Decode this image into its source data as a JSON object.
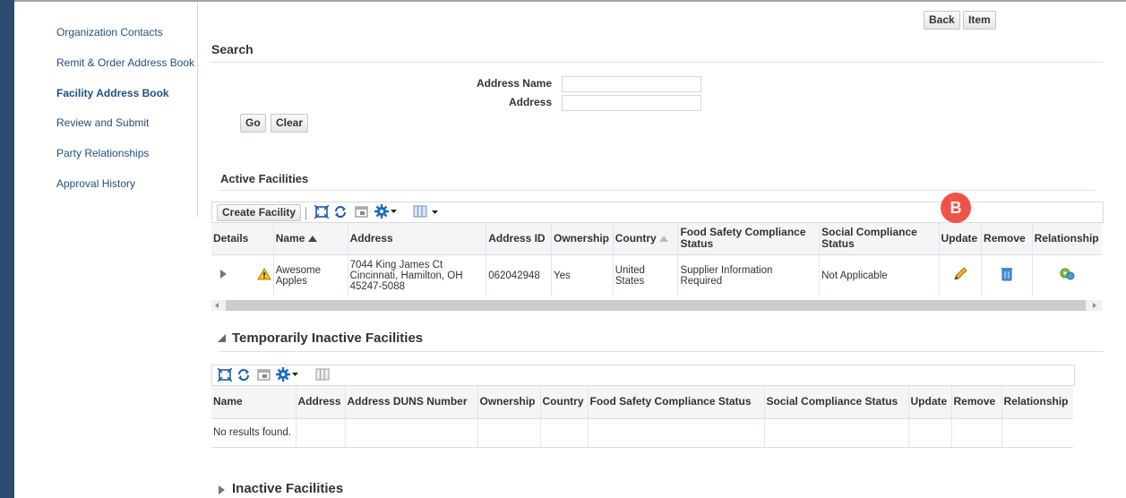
{
  "sidebar": {
    "items": [
      {
        "label": "Organization Contacts"
      },
      {
        "label": "Remit & Order Address Book"
      },
      {
        "label": "Facility Address Book"
      },
      {
        "label": "Review and Submit"
      },
      {
        "label": "Party Relationships"
      },
      {
        "label": "Approval History"
      }
    ]
  },
  "header": {
    "back_label": "Back",
    "item_label": "Item"
  },
  "search": {
    "title": "Search",
    "address_name_label": "Address Name",
    "address_label": "Address",
    "address_name_value": "",
    "address_value": "",
    "go_label": "Go",
    "clear_label": "Clear"
  },
  "active": {
    "title": "Active Facilities",
    "create_label": "Create Facility",
    "columns": [
      "Details",
      "Name",
      "Address",
      "Address ID",
      "Ownership",
      "Country",
      "Food Safety Compliance Status",
      "Social Compliance Status",
      "Update",
      "Remove",
      "Relationship"
    ],
    "rows": [
      {
        "name": "Awesome Apples",
        "address": "7044 King James Ct Cincinnati, Hamilton, OH 45247-5088",
        "address_id": "062042948",
        "ownership": "Yes",
        "country": "United States",
        "food_safety": "Supplier Information Required",
        "social": "Not Applicable"
      }
    ]
  },
  "annotation": {
    "label": "B",
    "color": "#f0524a"
  },
  "temp": {
    "title": "Temporarily Inactive Facilities",
    "columns": [
      "Name",
      "Address",
      "Address DUNS Number",
      "Ownership",
      "Country",
      "Food Safety Compliance Status",
      "Social Compliance Status",
      "Update",
      "Remove",
      "Relationship"
    ],
    "empty": "No results found."
  },
  "inactive": {
    "title": "Inactive Facilities"
  }
}
